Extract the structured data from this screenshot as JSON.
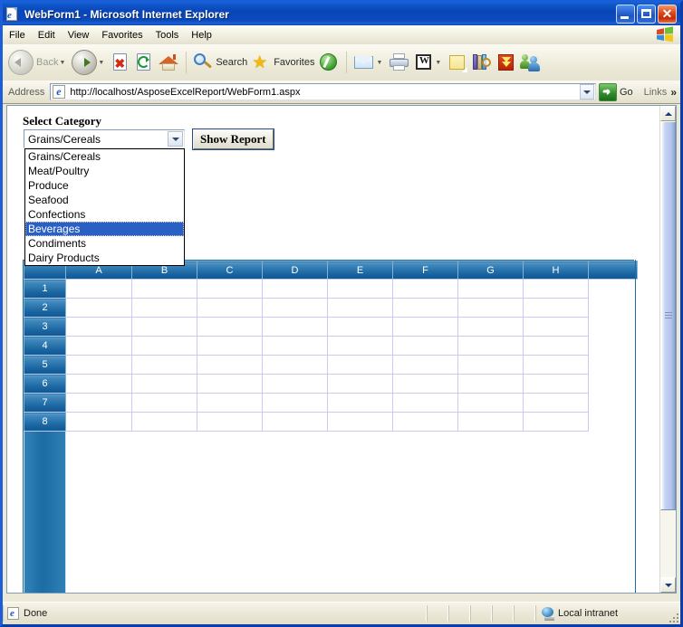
{
  "window": {
    "title": "WebForm1 - Microsoft Internet Explorer",
    "icon": "ie-document-icon",
    "minimize_label": "_",
    "maximize_label": "□",
    "close_label": "✕"
  },
  "menubar": {
    "items": [
      {
        "label": "File"
      },
      {
        "label": "Edit"
      },
      {
        "label": "View"
      },
      {
        "label": "Favorites"
      },
      {
        "label": "Tools"
      },
      {
        "label": "Help"
      }
    ],
    "brand_icon": "windows-flag-icon"
  },
  "toolbar": {
    "back_label": "Back",
    "back_enabled": false,
    "forward_label": "",
    "search_label": "Search",
    "favorites_label": "Favorites",
    "buttons": [
      {
        "name": "back",
        "icon": "back-arrow-icon"
      },
      {
        "name": "forward",
        "icon": "forward-arrow-icon"
      },
      {
        "name": "stop",
        "icon": "stop-icon"
      },
      {
        "name": "refresh",
        "icon": "refresh-icon"
      },
      {
        "name": "home",
        "icon": "home-icon"
      },
      {
        "name": "search",
        "icon": "magnifier-icon"
      },
      {
        "name": "favorites",
        "icon": "star-icon"
      },
      {
        "name": "media",
        "icon": "media-icon"
      },
      {
        "name": "mail",
        "icon": "mail-icon"
      },
      {
        "name": "print",
        "icon": "printer-icon"
      },
      {
        "name": "edit-word",
        "icon": "word-icon"
      },
      {
        "name": "notes",
        "icon": "note-icon"
      },
      {
        "name": "research",
        "icon": "research-books-icon"
      },
      {
        "name": "download",
        "icon": "download-icon"
      },
      {
        "name": "messenger",
        "icon": "messenger-icon"
      }
    ]
  },
  "address": {
    "label": "Address",
    "url": "http://localhost/AsposeExcelReport/WebForm1.aspx",
    "go_label": "Go",
    "links_label": "Links",
    "overflow_label": "»"
  },
  "page": {
    "select_label": "Select Category",
    "select_value": "Grains/Cereals",
    "options": [
      "Grains/Cereals",
      "Meat/Poultry",
      "Produce",
      "Seafood",
      "Confections",
      "Beverages",
      "Condiments",
      "Dairy Products"
    ],
    "highlighted_option": "Beverages",
    "dropdown_open": true,
    "show_report_label": "Show Report"
  },
  "grid": {
    "column_headers": [
      "A",
      "B",
      "C",
      "D",
      "E",
      "F",
      "G",
      "H",
      ""
    ],
    "row_headers": [
      "1",
      "2",
      "3",
      "4",
      "5",
      "6",
      "7",
      "8"
    ],
    "visible_row_headers": [
      "6",
      "7",
      "8"
    ],
    "cells": [
      [
        "",
        "",
        "",
        "",
        "",
        "",
        "",
        ""
      ],
      [
        "",
        "",
        "",
        "",
        "",
        "",
        "",
        ""
      ],
      [
        "",
        "",
        "",
        "",
        "",
        "",
        "",
        ""
      ],
      [
        "",
        "",
        "",
        "",
        "",
        "",
        "",
        ""
      ],
      [
        "",
        "",
        "",
        "",
        "",
        "",
        "",
        ""
      ],
      [
        "",
        "",
        "",
        "",
        "",
        "",
        "",
        ""
      ],
      [
        "",
        "",
        "",
        "",
        "",
        "",
        "",
        ""
      ],
      [
        "",
        "",
        "",
        "",
        "",
        "",
        "",
        ""
      ]
    ],
    "header_color": "#19639f",
    "gridline_color": "#c9c9f2"
  },
  "statusbar": {
    "status_text": "Done",
    "status_icon": "ie-icon",
    "zone_text": "Local intranet",
    "zone_icon": "globe-icon"
  }
}
